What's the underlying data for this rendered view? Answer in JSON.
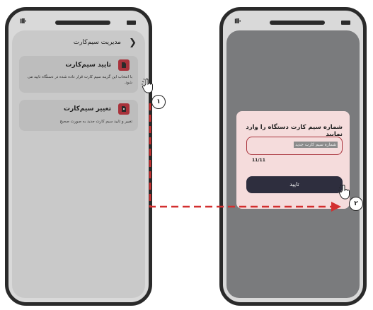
{
  "left_phone": {
    "status_signal": "Ill·",
    "header_title": "مدیریت سیم‌کارت",
    "back_icon": "chevron-right-icon",
    "cards": [
      {
        "title": "تایید سیم‌کارت",
        "description": "با انتخاب این گزینه سیم کارت قرار داده شده در دستگاه تایید می شود.",
        "icon": "sim-card-icon"
      },
      {
        "title": "تغییر سیم‌کارت",
        "description": "تغییر و تایید سیم کارت جدید به صورت صحیح",
        "icon": "sim-change-icon"
      }
    ]
  },
  "right_phone": {
    "status_signal": "Ill·",
    "dialog": {
      "title": "شماره سیم کارت دستگاه را وارد نمایید",
      "input_placeholder": "شماره سیم کارت جدید",
      "counter": "11/11",
      "submit_label": "تایید"
    }
  },
  "steps": {
    "one": "۱",
    "two": "۲"
  },
  "colors": {
    "dialog_bg": "#f5dcdc",
    "input_border": "#a8323b",
    "submit_bg": "#2e2e3e",
    "arrow": "#d32f2f"
  }
}
